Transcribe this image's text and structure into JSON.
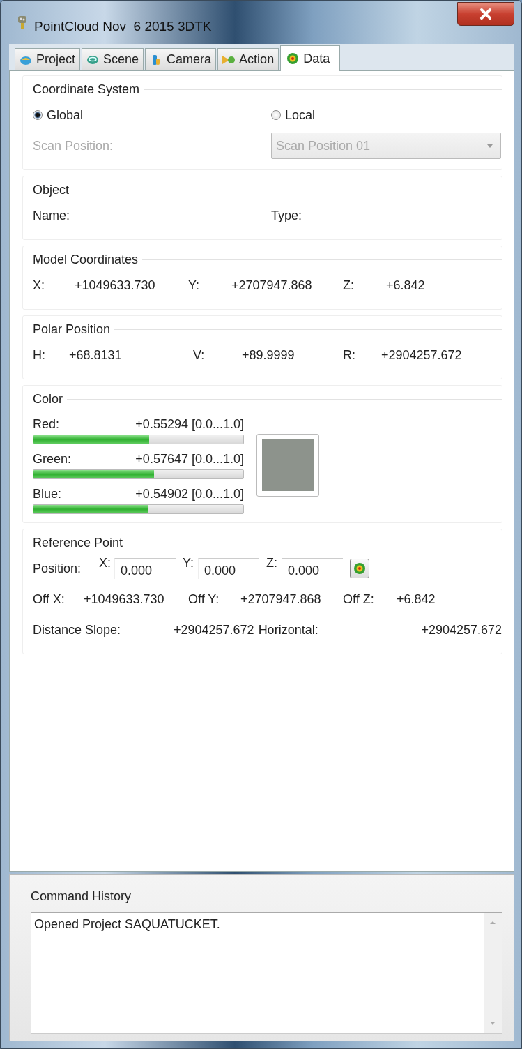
{
  "window": {
    "title": "PointCloud Nov  6 2015 3DTK"
  },
  "tabs": [
    {
      "label": "Project",
      "selected": false,
      "kind": "project"
    },
    {
      "label": "Scene",
      "selected": false,
      "kind": "scene"
    },
    {
      "label": "Camera",
      "selected": false,
      "kind": "camera"
    },
    {
      "label": "Action",
      "selected": false,
      "kind": "action"
    },
    {
      "label": "Data",
      "selected": true,
      "kind": "data"
    }
  ],
  "coordinate_system": {
    "title": "Coordinate System",
    "options": [
      {
        "label": "Global",
        "selected": true
      },
      {
        "label": "Local",
        "selected": false
      }
    ],
    "scan_position": {
      "label": "Scan Position:",
      "value": "Scan Position 01",
      "disabled": true
    }
  },
  "object": {
    "title": "Object",
    "fields": [
      {
        "label": "Name:"
      },
      {
        "label": "Type:"
      }
    ]
  },
  "model_coordinates": {
    "title": "Model Coordinates",
    "fields": [
      {
        "label": "X:",
        "value": "+1049633.730"
      },
      {
        "label": "Y:",
        "value": "+2707947.868"
      },
      {
        "label": "Z:",
        "value": "+6.842"
      }
    ]
  },
  "polar_position": {
    "title": "Polar Position",
    "fields": [
      {
        "label": "H:",
        "value": "+68.8131"
      },
      {
        "label": "V:",
        "value": "+89.9999"
      },
      {
        "label": "R:",
        "value": "+2904257.672"
      }
    ]
  },
  "color": {
    "title": "Color",
    "channels": [
      {
        "name": "Red:",
        "reading": "+0.55294 [0.0...1.0]",
        "level": 0.553
      },
      {
        "name": "Green:",
        "reading": "+0.57647 [0.0...1.0]",
        "level": 0.576
      },
      {
        "name": "Blue:",
        "reading": "+0.54902 [0.0...1.0]",
        "level": 0.549
      }
    ]
  },
  "reference_point": {
    "title": "Reference Point",
    "position_label": "Position:",
    "inputs": [
      {
        "label": "X:",
        "value": "0.000"
      },
      {
        "label": "Y:",
        "value": "0.000"
      },
      {
        "label": "Z:",
        "value": "0.000"
      }
    ],
    "offsets": [
      {
        "label": "Off X:",
        "value": "+1049633.730"
      },
      {
        "label": "Off Y:",
        "value": "+2707947.868"
      },
      {
        "label": "Off Z:",
        "value": "+6.842"
      }
    ],
    "distances": [
      {
        "label": "Distance Slope:",
        "value": "+2904257.672"
      },
      {
        "label": "Horizontal:",
        "value": "+2904257.672"
      }
    ]
  },
  "command_history": {
    "title": "Command History",
    "lines": [
      "Opened Project SAQUATUCKET."
    ]
  }
}
